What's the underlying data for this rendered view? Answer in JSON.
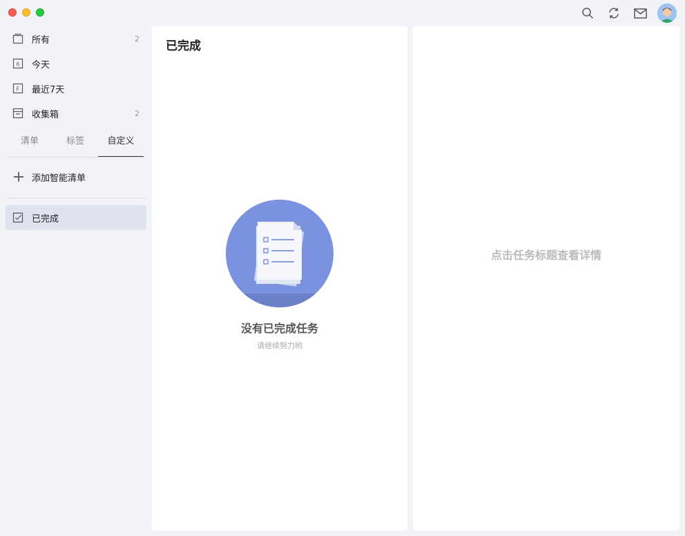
{
  "window": {
    "traffic_lights": [
      "close",
      "minimize",
      "zoom"
    ]
  },
  "toolbar": {
    "icons": [
      "search-icon",
      "sync-icon",
      "mail-icon",
      "avatar"
    ]
  },
  "sidebar": {
    "items": [
      {
        "label": "所有",
        "count": "2",
        "icon": "all-icon"
      },
      {
        "label": "今天",
        "count": "",
        "icon": "calendar-today-icon",
        "day": "6"
      },
      {
        "label": "最近7天",
        "count": "",
        "icon": "calendar-week-icon",
        "day": "F"
      },
      {
        "label": "收集箱",
        "count": "2",
        "icon": "inbox-icon"
      }
    ],
    "tabs": [
      {
        "label": "清单"
      },
      {
        "label": "标签"
      },
      {
        "label": "自定义",
        "active": true
      }
    ],
    "add_smart_list": "添加智能清单",
    "completed": "已完成"
  },
  "main": {
    "title": "已完成",
    "empty_title": "没有已完成任务",
    "empty_subtitle": "请继续努力哟"
  },
  "detail": {
    "hint": "点击任务标题查看详情"
  },
  "colors": {
    "accent": "#7b93de",
    "selected_bg": "#dfe3ef"
  }
}
